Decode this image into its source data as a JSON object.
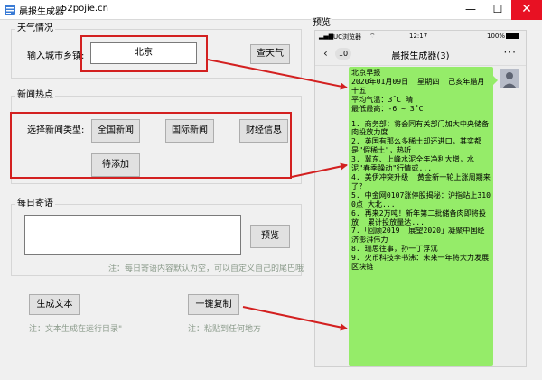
{
  "window": {
    "title": "晨报生成器",
    "subtitle": "52pojie.cn",
    "controls": {
      "minimize": "—",
      "maximize": "☐",
      "close": "✕"
    }
  },
  "weather": {
    "group_title": "天气情况",
    "city_label": "输入城市乡镇:",
    "city_value": "北京",
    "check_button": "查天气"
  },
  "news": {
    "group_title": "新闻热点",
    "type_label": "选择新闻类型:",
    "buttons": [
      "全国新闻",
      "国际新闻",
      "财经信息",
      "待添加"
    ]
  },
  "message": {
    "group_title": "每日寄语",
    "preview_button": "预览",
    "note": "注：每日寄语内容默认为空，可以自定义自己的尾巴哦"
  },
  "actions": {
    "generate_button": "生成文本",
    "generate_note": "注：文本生成在运行目录\"",
    "copy_button": "一键复制",
    "copy_note": "注：粘贴到任何地方"
  },
  "preview": {
    "group_title": "预览",
    "status_bar": {
      "signal": "▂▄▆",
      "carrier": "UC浏览器",
      "wifi": "⌔",
      "time": "12:17",
      "battery": "100%"
    },
    "chat": {
      "back": "‹",
      "unread": "10",
      "title": "晨报生成器(3)",
      "more": "···"
    },
    "header_lines": [
      "北京早报",
      "2020年01月09日  星期四  己亥年腊月十五",
      "平均气温：3˚C 晴",
      "最低最高：-6 ~ 3˚C"
    ],
    "news_lines": [
      "1. 商务部：将会同有关部门加大中央储备肉投放力度",
      "2. 英国有那么多稀土却还进口，其实都是\"假稀土\"，热听",
      "3. 冀东、上峰水泥全年净利大增，水泥\"春季躁动\"行情或...",
      "4. 美伊冲突升级  黄金新一轮上涨周期来了？",
      "5. 中金网0107涨停股揭秘：沪指站上3100点 大北...",
      "6. 再来2万吨！新年第二批储备肉即将投放  累计投放量达...",
      "7.「回顾2019  展望2020」凝聚中国经济澎湃伟力",
      "8. 瑞思往事，孙一丁浮沉",
      "9. 火币科技李书沸：未来一年将大力发展区块链"
    ]
  },
  "colors": {
    "bubble": "#95ec69",
    "annotation_red": "#d32020",
    "close_button": "#e81123",
    "note_text": "#8a9a8a"
  }
}
